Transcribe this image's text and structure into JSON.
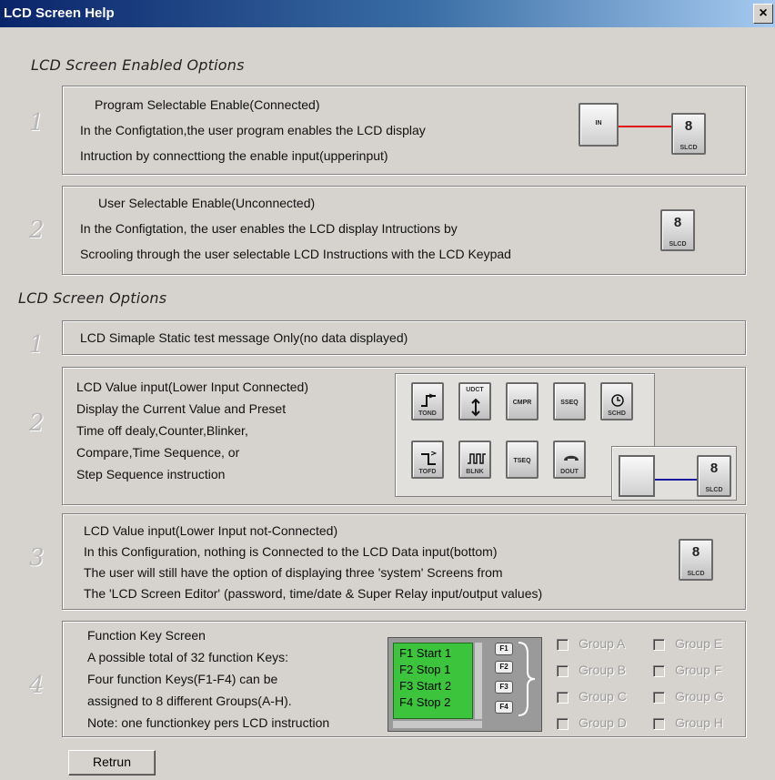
{
  "window": {
    "title": "LCD Screen Help",
    "close_label": "×"
  },
  "enabled_section": {
    "title": "LCD Screen Enabled Options",
    "items": [
      {
        "num": "1",
        "lines": [
          "Program Selectable Enable(Connected)",
          "In the Configtation,the user program  enables the LCD display",
          "Intruction by connecttiong the enable input(upperinput)"
        ]
      },
      {
        "num": "2",
        "lines": [
          "User Selectable Enable(Unconnected)",
          "In the Configtation, the user  enables the LCD display  Intructions by",
          "Scrooling through the  user selectable LCD Instructions with  the LCD  Keypad"
        ]
      }
    ]
  },
  "options_section": {
    "title": "LCD Screen Options",
    "items": [
      {
        "num": "1",
        "lines": [
          "LCD Simaple Static test message Only(no data displayed)"
        ]
      },
      {
        "num": "2",
        "lines": [
          "LCD Value input(Lower Input Connected)",
          "Display the Current Value and Preset",
          "Time off dealy,Counter,Blinker,",
          "Compare,Time Sequence, or",
          "Step Sequence instruction"
        ]
      },
      {
        "num": "3",
        "lines": [
          "LCD Value input(Lower Input not-Connected)",
          "In this Configuration, nothing is Connected to the LCD Data input(bottom)",
          "The user will still  have the option of displaying three 'system' Screens from",
          " The 'LCD Screen Editor' (password, time/date & Super Relay input/output values)"
        ]
      },
      {
        "num": "4",
        "lines": [
          "Function Key Screen",
          "A possible total of 32 function Keys:",
          "Four function Keys(F1-F4) can be",
          "assigned to 8 different Groups(A-H).",
          "Note: one functionkey pers LCD instruction"
        ]
      }
    ]
  },
  "tiles": {
    "in_label": "IN",
    "slcd_big": "8",
    "slcd_label": "SLCD",
    "row1": [
      "TOND",
      "UDCT",
      "CMPR",
      "SSEQ",
      "SCHD"
    ],
    "row2": [
      "TOFD",
      "BLNK",
      "TSEQ",
      "DOUT"
    ]
  },
  "function_keys": {
    "lines": [
      "F1 Start 1",
      "F2 Stop 1",
      "F3 Start 2",
      "F4 Stop 2"
    ],
    "keys": [
      "F1",
      "F2",
      "F3",
      "F4"
    ]
  },
  "groups": {
    "left": [
      "Group A",
      "Group B",
      "Group C",
      "Group D"
    ],
    "right": [
      "Group E",
      "Group F",
      "Group G",
      "Group H"
    ]
  },
  "return_label": "Retrun",
  "colors": {
    "red_wire": "#e01010",
    "blue_wire": "#1a1aa0",
    "fk_green": "#3cc43c"
  }
}
